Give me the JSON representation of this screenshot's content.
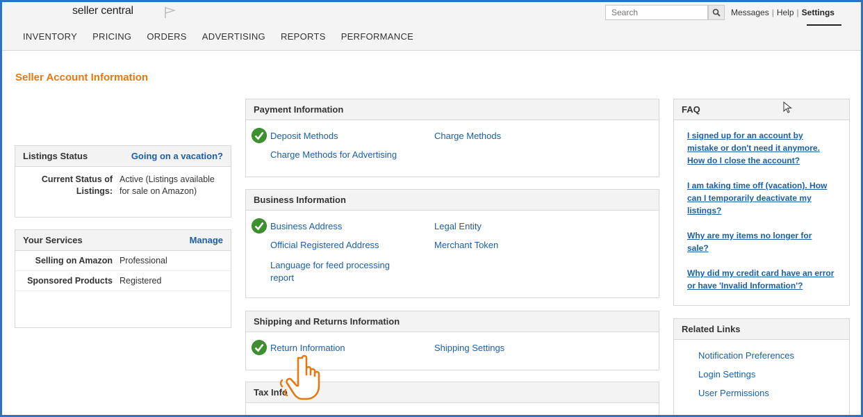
{
  "header": {
    "logo": "seller central",
    "search_placeholder": "Search",
    "links": [
      "Messages",
      "Help",
      "Settings"
    ],
    "nav": [
      "INVENTORY",
      "PRICING",
      "ORDERS",
      "ADVERTISING",
      "REPORTS",
      "PERFORMANCE"
    ]
  },
  "page": {
    "title": "Seller Account Information"
  },
  "listings": {
    "title": "Listings Status",
    "action": "Going on a vacation?",
    "key": "Current Status of Listings:",
    "value": "Active (Listings available for sale on Amazon)"
  },
  "services": {
    "title": "Your Services",
    "action": "Manage",
    "rows": [
      {
        "k": "Selling on Amazon",
        "v": "Professional"
      },
      {
        "k": "Sponsored Products",
        "v": "Registered"
      }
    ]
  },
  "payment": {
    "title": "Payment Information",
    "links": [
      "Deposit Methods",
      "Charge Methods",
      "Charge Methods for Advertising"
    ]
  },
  "business": {
    "title": "Business Information",
    "links": [
      "Business Address",
      "Legal Entity",
      "Official Registered Address",
      "Merchant Token",
      "Language for feed processing report"
    ]
  },
  "shipping": {
    "title": "Shipping and Returns Information",
    "links": [
      "Return Information",
      "Shipping Settings"
    ]
  },
  "tax": {
    "title": "Tax Info"
  },
  "faq": {
    "title": "FAQ",
    "items": [
      "I signed up for an account by mistake or don't need it anymore. How do I close the account?",
      "I am taking time off (vacation). How can I temporarily deactivate my listings?",
      "Why are my items no longer for sale?",
      "Why did my credit card have an error or have 'Invalid Information'?"
    ]
  },
  "related": {
    "title": "Related Links",
    "links": [
      "Notification Preferences",
      "Login Settings",
      "User Permissions"
    ]
  },
  "colors": {
    "accent": "#e47911",
    "link": "#1a5fa8",
    "check": "#3d8f2f",
    "frame": "#2a73c2"
  }
}
